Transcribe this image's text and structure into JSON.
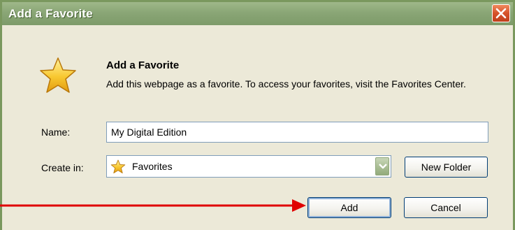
{
  "window": {
    "title": "Add a Favorite"
  },
  "header": {
    "heading": "Add a Favorite",
    "description": "Add this webpage as a favorite. To access your favorites, visit the Favorites Center."
  },
  "form": {
    "name_label": "Name:",
    "name_value": "My Digital Edition",
    "create_in_label": "Create in:",
    "create_in_value": "Favorites",
    "new_folder_label": "New Folder"
  },
  "buttons": {
    "add_label": "Add",
    "cancel_label": "Cancel"
  },
  "icons": {
    "header_icon": "star-icon",
    "folder_icon": "star-icon",
    "close_icon": "close-icon",
    "dropdown_icon": "chevron-down-icon"
  },
  "colors": {
    "titlebar": "#8aa676",
    "dialog_bg": "#ece9d8",
    "close_button": "#d6522a",
    "annotation_arrow": "#e00000"
  }
}
